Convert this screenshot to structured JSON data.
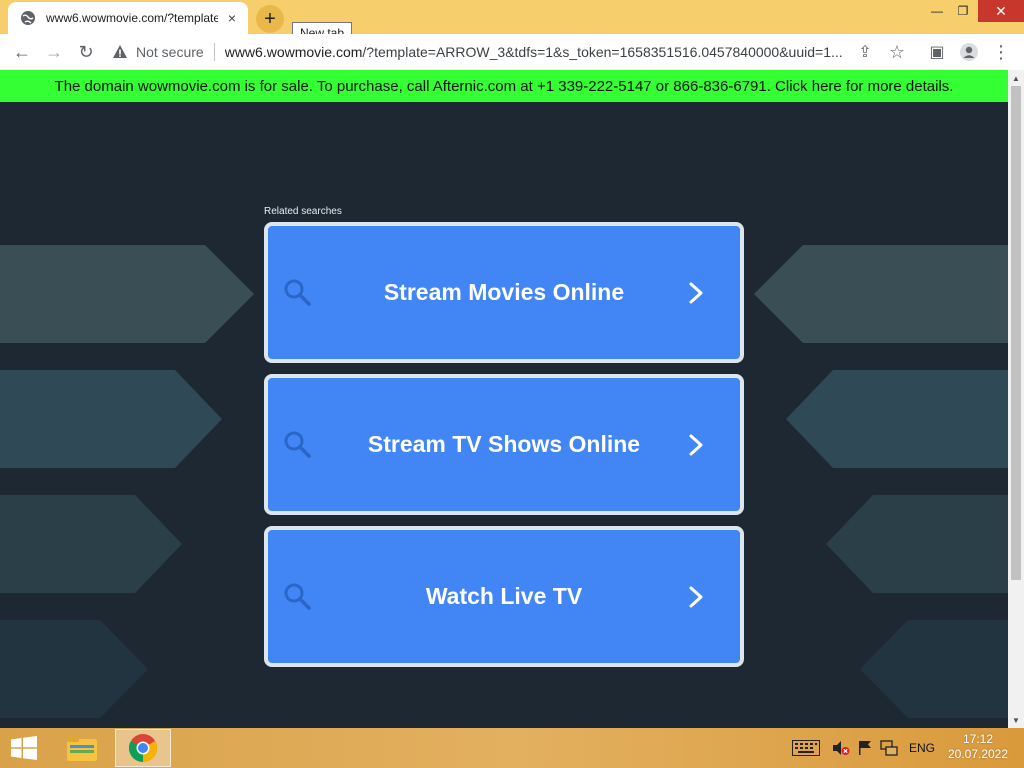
{
  "browser": {
    "tab": {
      "title": "www6.wowmovie.com/?template",
      "close_glyph": "×"
    },
    "new_tab_glyph": "+",
    "tooltip": "New tab",
    "window_controls": {
      "minimize": "—",
      "restore": "❐",
      "close": "✕"
    },
    "toolbar": {
      "back_glyph": "←",
      "forward_glyph": "→",
      "reload_glyph": "↻",
      "security_label": "Not secure",
      "url_host": "www6.wowmovie.com",
      "url_rest": "/?template=ARROW_3&tdfs=1&s_token=1658351516.0457840000&uuid=1...",
      "share_glyph": "⇪",
      "star_glyph": "☆",
      "sidepanel_glyph": "▣",
      "menu_glyph": "⋮"
    }
  },
  "page": {
    "sale_banner": "The domain wowmovie.com is for sale. To purchase, call Afternic.com at +1 339-222-5147 or 866-836-6791. Click here for more details.",
    "related_label": "Related searches",
    "searches": [
      {
        "label": "Stream Movies Online"
      },
      {
        "label": "Stream TV Shows Online"
      },
      {
        "label": "Watch Live TV"
      }
    ],
    "colors": {
      "banner_bg": "#33ff33",
      "page_bg": "#1d2833",
      "card_bg": "#4285f4",
      "card_border": "#dce6ee",
      "icon_blue": "#2a66c8"
    }
  },
  "taskbar": {
    "language": "ENG",
    "time": "17:12",
    "date": "20.07.2022"
  }
}
